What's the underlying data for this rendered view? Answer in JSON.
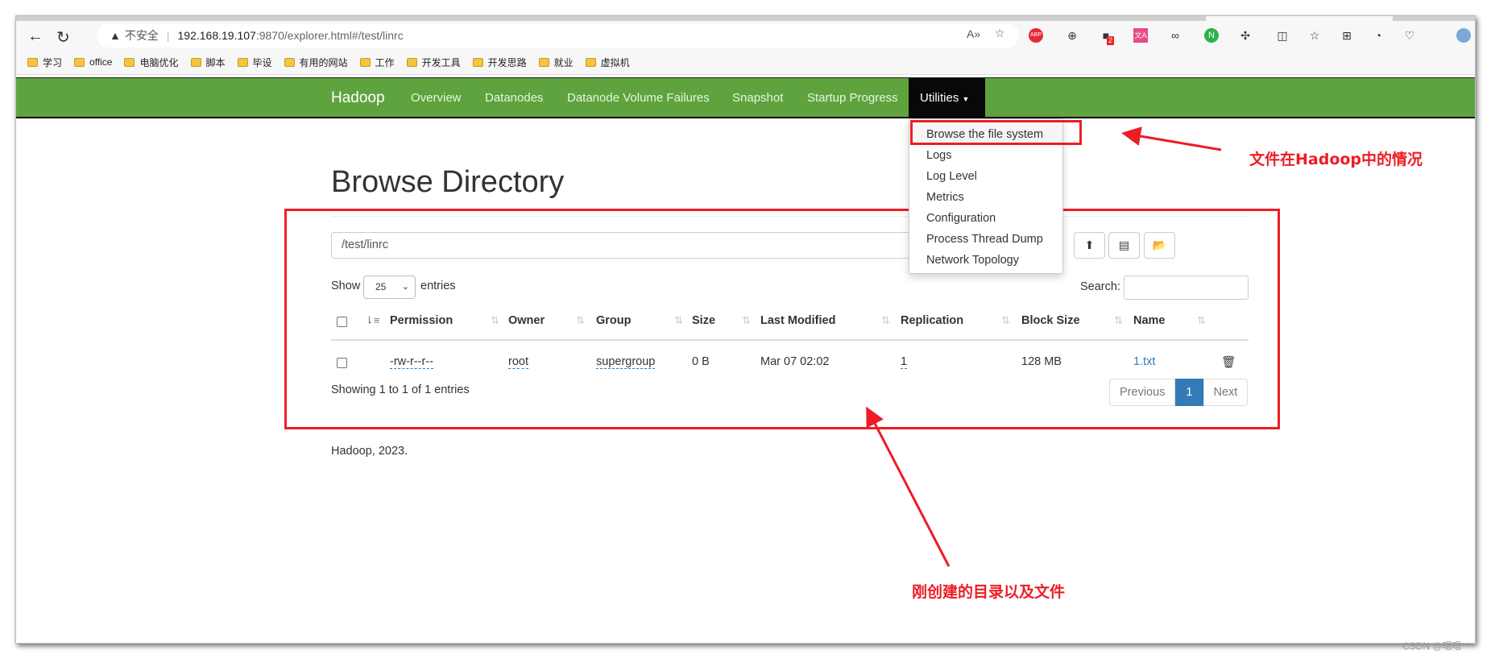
{
  "browser": {
    "security_label": "不安全",
    "url_host": "192.168.19.107",
    "url_rest": ":9870/explorer.html#/test/linrc",
    "bookmarks": [
      "学习",
      "office",
      "电脑优化",
      "脚本",
      "毕设",
      "有用的网站",
      "工作",
      "开发工具",
      "开发思路",
      "就业",
      "虚拟机"
    ],
    "extension_badge": "2"
  },
  "nav": {
    "brand": "Hadoop",
    "items": [
      "Overview",
      "Datanodes",
      "Datanode Volume Failures",
      "Snapshot",
      "Startup Progress"
    ],
    "utilities": "Utilities",
    "dropdown": [
      "Browse the file system",
      "Logs",
      "Log Level",
      "Metrics",
      "Configuration",
      "Process Thread Dump",
      "Network Topology"
    ]
  },
  "page": {
    "title": "Browse Directory",
    "path_value": "/test/linrc",
    "show_label": "Show",
    "entries_select": "25",
    "entries_label": "entries",
    "search_label": "Search:",
    "columns": [
      "Permission",
      "Owner",
      "Group",
      "Size",
      "Last Modified",
      "Replication",
      "Block Size",
      "Name"
    ],
    "rows": [
      {
        "permission": "-rw-r--r--",
        "owner": "root",
        "group": "supergroup",
        "size": "0 B",
        "modified": "Mar 07 02:02",
        "replication": "1",
        "block_size": "128 MB",
        "name": "1.txt"
      }
    ],
    "info": "Showing 1 to 1 of 1 entries",
    "pagination": {
      "previous": "Previous",
      "current": "1",
      "next": "Next"
    },
    "footer": "Hadoop, 2023."
  },
  "annotations": {
    "top": "文件在Hadoop中的情况",
    "bottom": "刚创建的目录以及文件",
    "color": "#ee1c25"
  },
  "watermark": "CSDN @嗯嗯**",
  "colors": {
    "navbar": "#5fa33e",
    "active_page": "#337ab7",
    "link": "#337ab7"
  }
}
